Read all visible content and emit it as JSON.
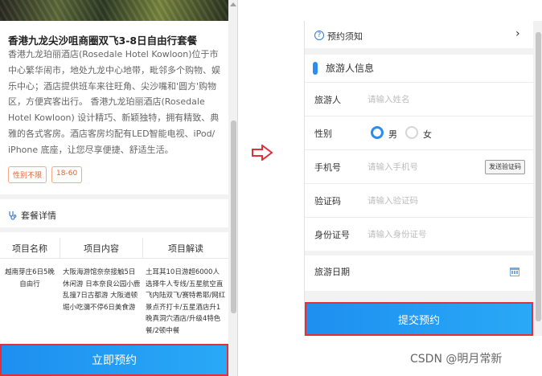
{
  "left": {
    "title": "香港九龙尖沙咀商圈双飞3-8日自由行套餐",
    "description": "香港九龙珀丽酒店(Rosedale Hotel Kowloon)位于市中心繁华闹市，地处九龙中心地带，毗邻多个购物、娱乐中心；酒店提供班车来往旺角、尖沙嘴和'圆方'购物区，方便宾客出行。 香港九龙珀丽酒店(Rosedale Hotel Kowloon) 设计精巧、新颖独特，拥有精致、典雅的各式客房。酒店客房均配有LED智能电视、iPod/ iPhone 底座，让您尽享便捷、舒适生活。",
    "tags": [
      "性别不限",
      "18-60"
    ],
    "package_details": "套餐详情",
    "table": {
      "headers": [
        "项目名称",
        "项目内容",
        "项目解读"
      ],
      "row": [
        "越南芽庄6日5晚自由行",
        "大阪海游馆奈奈接触5日休闲游 日本奈良公园小鹿乱撞7日古都游 大阪道顿堀小吃瀰不停6日美食游",
        "土耳其10日游超6000人选择牛人专线/五星航空直飞内陆双飞/赛特希耶/网红景点齐打卡/五星酒店升1晚真洞穴酒店/升级4特色餐/2顿中餐"
      ]
    },
    "book_button": "立即预约"
  },
  "right": {
    "notice": "预约须知",
    "section_title": "旅游人信息",
    "fields": {
      "traveler_label": "旅游人",
      "traveler_placeholder": "请输入姓名",
      "gender_label": "性别",
      "gender_male": "男",
      "gender_female": "女",
      "phone_label": "手机号",
      "phone_placeholder": "请输入手机号",
      "send_code": "发送验证码",
      "code_label": "验证码",
      "code_placeholder": "请输入验证码",
      "id_label": "身份证号",
      "id_placeholder": "请输入身份证号",
      "date_label": "旅游日期"
    },
    "submit_button": "提交预约"
  },
  "watermark": "CSDN @明月常新",
  "colors": {
    "accent": "#2d8cf0",
    "highlight_border": "#e0303a",
    "tag_orange": "#e8612c",
    "arrow_red": "#e0303a"
  }
}
